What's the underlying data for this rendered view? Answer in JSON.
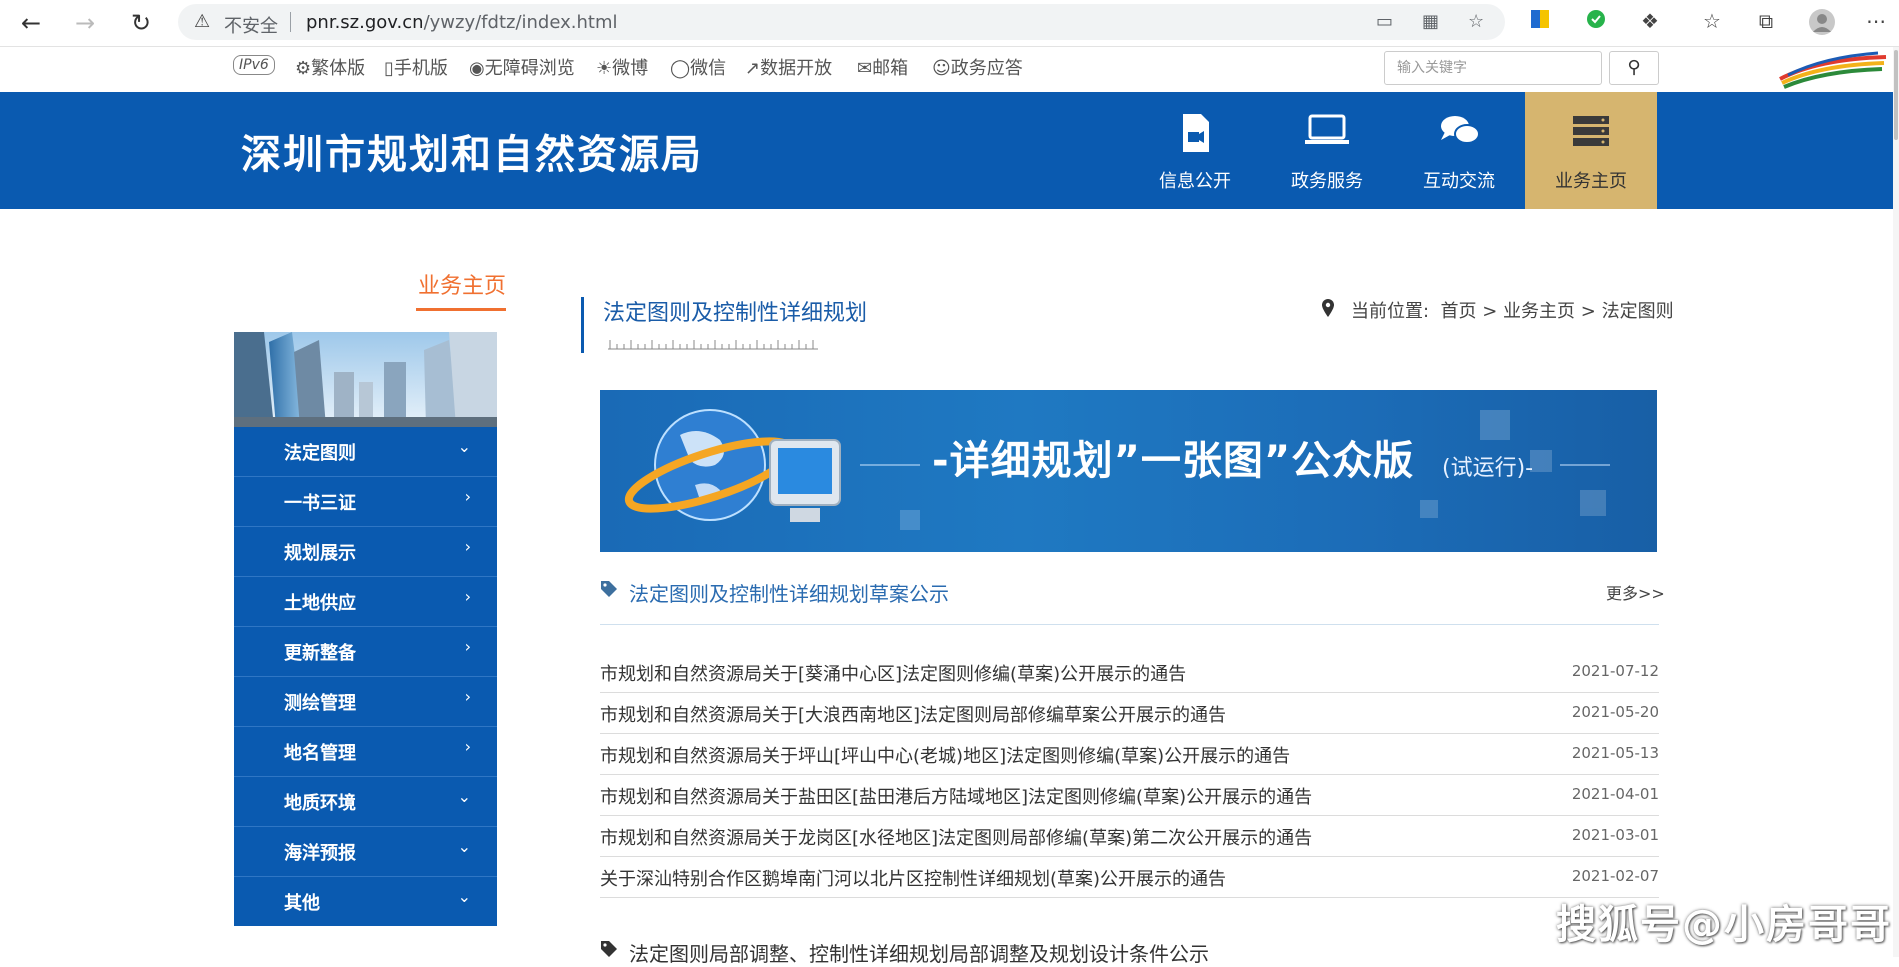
{
  "browser": {
    "security_label": "不安全",
    "url_host": "pnr.sz.gov.cn",
    "url_path": "/ywzy/fdtz/index.html"
  },
  "utility": {
    "ipv6": "IPv6",
    "links": [
      "繁体版",
      "手机版",
      "无障碍浏览",
      "微博",
      "微信",
      "数据开放",
      "邮箱",
      "政务应答"
    ],
    "search_placeholder": "输入关键字"
  },
  "header": {
    "site_title": "深圳市规划和自然资源局",
    "nav": [
      {
        "label": "信息公开",
        "icon": "document-video-icon"
      },
      {
        "label": "政务服务",
        "icon": "laptop-icon"
      },
      {
        "label": "互动交流",
        "icon": "chat-bubbles-icon"
      },
      {
        "label": "业务主页",
        "icon": "server-stack-icon",
        "active": true
      }
    ],
    "active_color": "#d6b56f",
    "brand_color": "#0a5ab0"
  },
  "sidebar": {
    "title": "业务主页",
    "items": [
      {
        "label": "法定图则",
        "chevron": "down"
      },
      {
        "label": "一书三证",
        "chevron": "right"
      },
      {
        "label": "规划展示",
        "chevron": "right"
      },
      {
        "label": "土地供应",
        "chevron": "right"
      },
      {
        "label": "更新整备",
        "chevron": "right"
      },
      {
        "label": "测绘管理",
        "chevron": "right"
      },
      {
        "label": "地名管理",
        "chevron": "right"
      },
      {
        "label": "地质环境",
        "chevron": "down"
      },
      {
        "label": "海洋预报",
        "chevron": "down"
      },
      {
        "label": "其他",
        "chevron": "down"
      }
    ]
  },
  "main": {
    "page_title": "法定图则及控制性详细规划",
    "breadcrumb_label": "当前位置:",
    "breadcrumb": "首页 > 业务主页 > 法定图则",
    "banner_main": "-详细规划”一张图”公众版",
    "banner_sub": "(试运行)-",
    "section_title": "法定图则及控制性详细规划草案公示",
    "more_label": "更多>>",
    "notices": [
      {
        "title": "市规划和自然资源局关于[葵涌中心区]法定图则修编(草案)公开展示的通告",
        "date": "2021-07-12"
      },
      {
        "title": "市规划和自然资源局关于[大浪西南地区]法定图则局部修编草案公开展示的通告",
        "date": "2021-05-20"
      },
      {
        "title": "市规划和自然资源局关于坪山[坪山中心(老城)地区]法定图则修编(草案)公开展示的通告",
        "date": "2021-05-13"
      },
      {
        "title": "市规划和自然资源局关于盐田区[盐田港后方陆域地区]法定图则修编(草案)公开展示的通告",
        "date": "2021-04-01"
      },
      {
        "title": "市规划和自然资源局关于龙岗区[水径地区]法定图则局部修编(草案)第二次公开展示的通告",
        "date": "2021-03-01"
      },
      {
        "title": "关于深汕特别合作区鹅埠南门河以北片区控制性详细规划(草案)公开展示的通告",
        "date": "2021-02-07"
      }
    ],
    "section2_title": "法定图则局部调整、控制性详细规划局部调整及规划设计条件公示"
  },
  "watermark": "搜狐号@小房哥哥"
}
